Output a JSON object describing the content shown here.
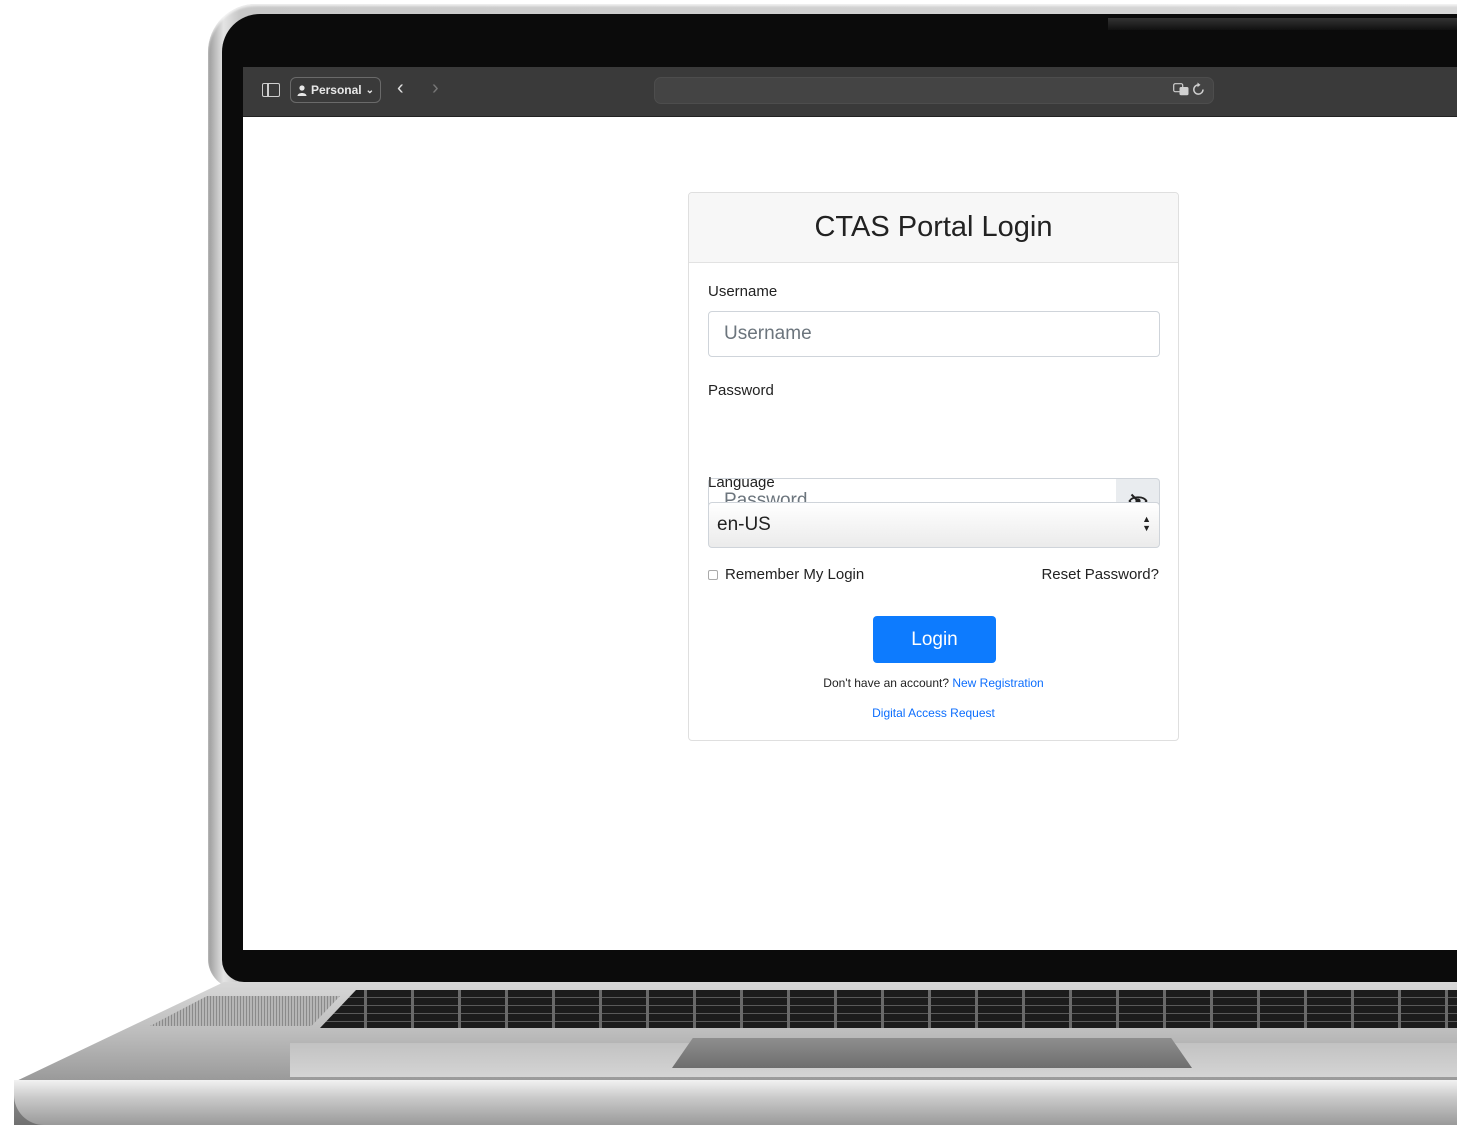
{
  "browser": {
    "profile_label": "Personal",
    "profile_chevron": "⌄",
    "back_glyph": "‹",
    "forward_glyph": "›",
    "icons": [
      "sidebar-icon",
      "person-icon",
      "chevron-down-icon",
      "back-icon",
      "forward-icon",
      "translate-icon",
      "reload-icon"
    ]
  },
  "login": {
    "title": "CTAS Portal Login",
    "username_label": "Username",
    "username_placeholder": "Username",
    "password_label": "Password",
    "password_placeholder": "Password",
    "language_label": "Language",
    "language_value": "en-US",
    "remember_label": "Remember My Login",
    "remember_checked": false,
    "reset_label": "Reset Password?",
    "login_label": "Login",
    "no_account_text": "Don't have an account?",
    "register_label": "New Registration",
    "digital_access_label": "Digital Access Request",
    "icons": [
      "eye-slash-icon",
      "select-arrows-icon"
    ]
  },
  "colors": {
    "primary": "#0d7bfe",
    "link": "#0d6efd",
    "toolbar": "#3a3a3a"
  }
}
